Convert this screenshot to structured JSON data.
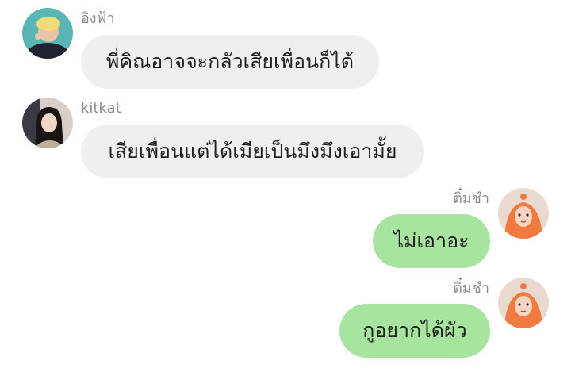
{
  "messages": [
    {
      "sender": "อิงฟ้า",
      "text": "พี่คิณอาจจะกลัวเสียเพื่อนก็ได้",
      "direction": "incoming",
      "avatar_icon": "user-avatar-teal-icon"
    },
    {
      "sender": "kitkat",
      "text": "เสียเพื่อนแต่ได้เมียเป็นมึงมึงเอามั้ย",
      "direction": "incoming",
      "avatar_icon": "user-avatar-dark-hair-icon"
    },
    {
      "sender": "ติ๋มชำ",
      "text": "ไม่เอาอะ",
      "direction": "outgoing",
      "avatar_icon": "user-avatar-orange-hood-icon"
    },
    {
      "sender": "ติ๋มชำ",
      "text": "กูอยากได้ผัว",
      "direction": "outgoing",
      "avatar_icon": "user-avatar-orange-hood-icon"
    }
  ],
  "colors": {
    "incoming_bubble": "#efefef",
    "outgoing_bubble": "#a6e4a0",
    "sender_name": "#8a8a8a",
    "message_text": "#1e1e1e"
  }
}
